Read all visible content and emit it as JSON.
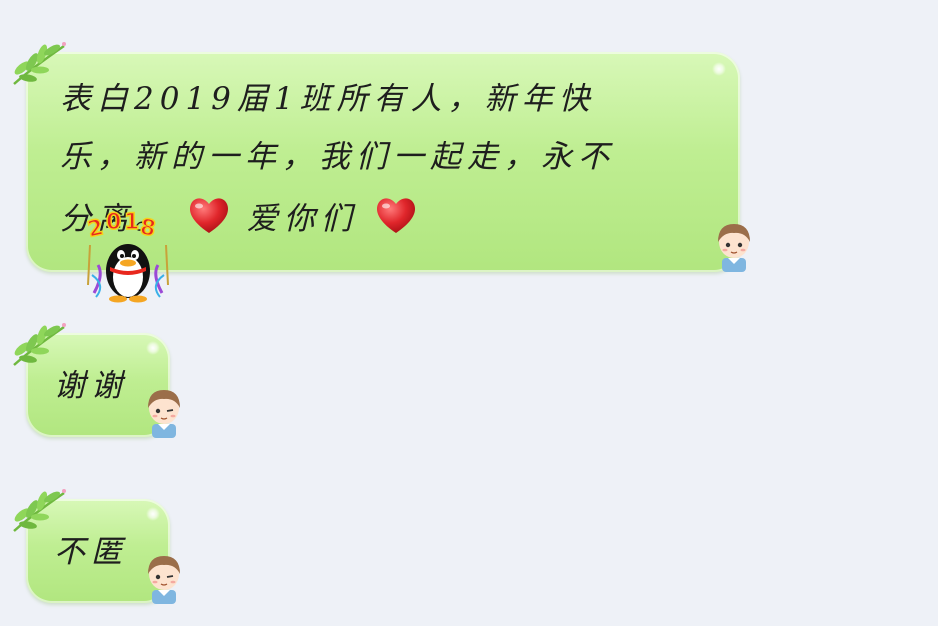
{
  "chat": {
    "messages": [
      {
        "line1": "表白2019届1班所有人，新年快",
        "line2": "乐，新的一年，我们一起走，永不",
        "line3_start": "分离。",
        "line3_mid": "爱你们",
        "sticker_text": "2018"
      },
      {
        "text": "谢谢"
      },
      {
        "text": "不匿"
      }
    ]
  },
  "colors": {
    "bubble_top": "#d8f8b8",
    "bubble_bottom": "#b1e67f",
    "background": "#eef1f7",
    "heart": "#e0262b",
    "leaf": "#7ec850"
  },
  "icons": [
    "leaf-decoration-icon",
    "heart-icon",
    "penguin-2018-sticker",
    "avatar-icon"
  ]
}
